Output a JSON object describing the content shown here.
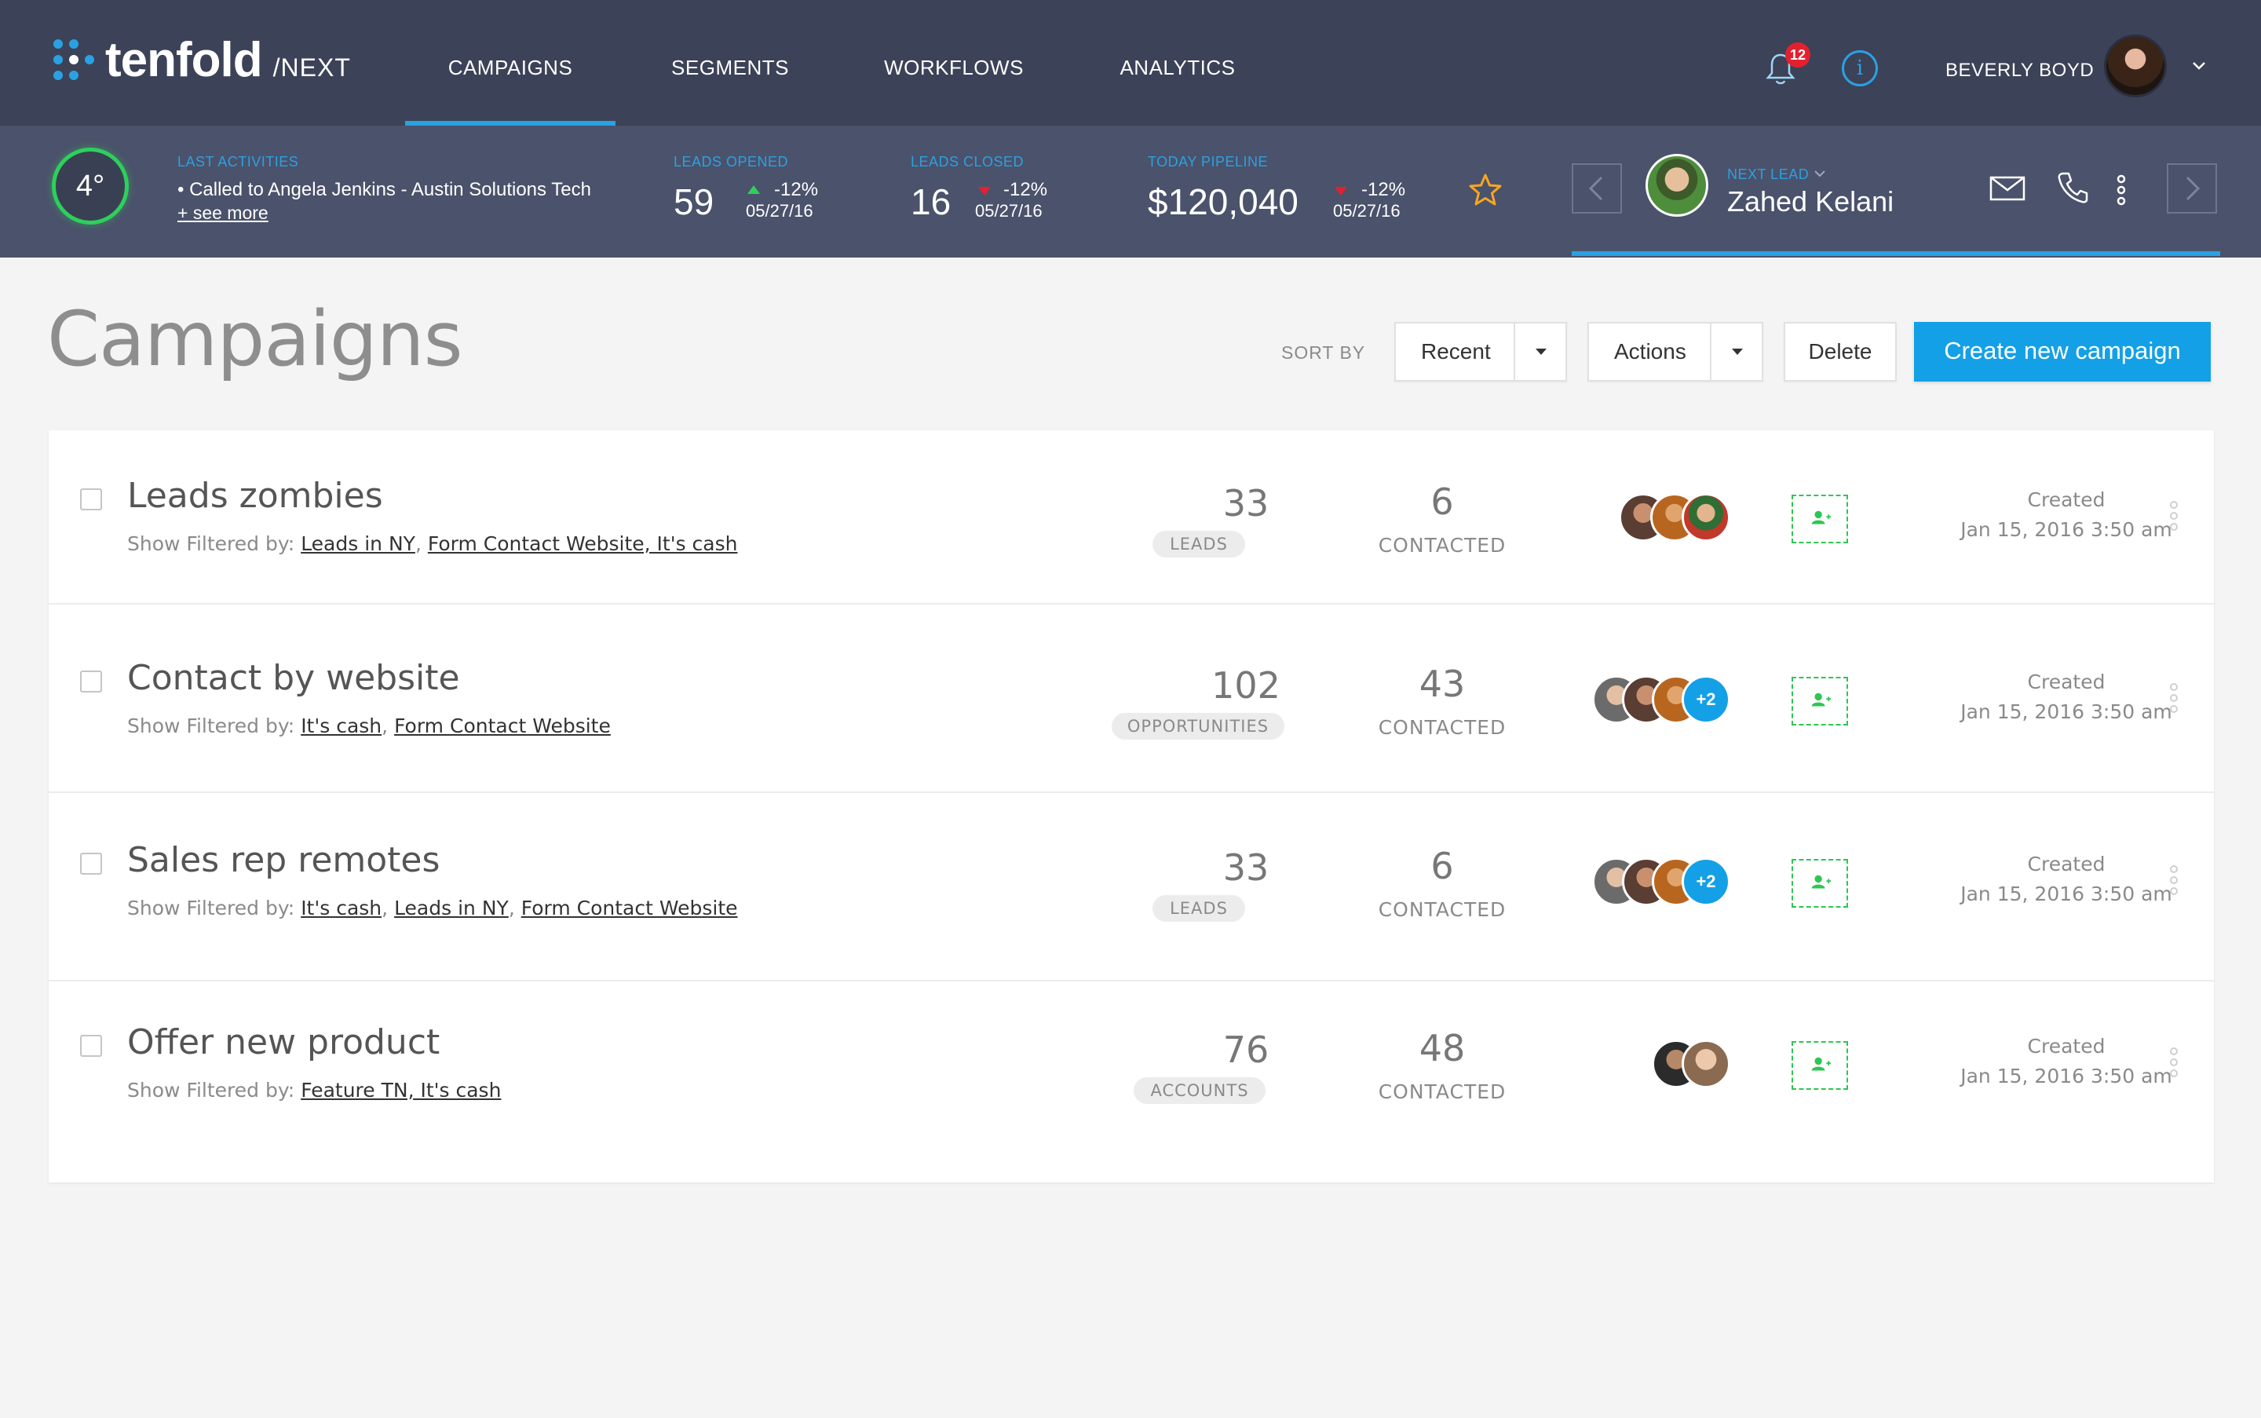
{
  "app": {
    "logo_word": "tenfold",
    "logo_suffix": "/NEXT"
  },
  "nav": {
    "tabs": [
      {
        "label": "CAMPAIGNS",
        "active": true
      },
      {
        "label": "SEGMENTS",
        "active": false
      },
      {
        "label": "WORKFLOWS",
        "active": false
      },
      {
        "label": "ANALYTICS",
        "active": false
      }
    ],
    "notifications_count": "12",
    "info_glyph": "i",
    "user_name": "BEVERLY BOYD"
  },
  "stats": {
    "temperature": "4°",
    "last_activities_label": "LAST  ACTIVITIES",
    "last_activity": "• Called to Angela Jenkins - Austin Solutions Tech",
    "see_more": "+ see more",
    "leads_opened": {
      "label": "LEADS OPENED",
      "value": "59",
      "change": "-12%",
      "date": "05/27/16",
      "trend": "up"
    },
    "leads_closed": {
      "label": "LEADS CLOSED",
      "value": "16",
      "change": "-12%",
      "date": "05/27/16",
      "trend": "down"
    },
    "pipeline": {
      "label": "TODAY PIPELINE",
      "value": "$120,040",
      "change": "-12%",
      "date": "05/27/16",
      "trend": "down"
    },
    "next_lead_label": "NEXT LEAD",
    "next_lead_name": "Zahed Kelani"
  },
  "page": {
    "title": "Campaigns",
    "sort_by_label": "SORT BY",
    "sort_value": "Recent",
    "actions_label": "Actions",
    "delete_label": "Delete",
    "create_label": "Create new campaign"
  },
  "campaigns": [
    {
      "name": "Leads zombies",
      "filter_prefix": "Show Filtered  by:",
      "filters": [
        "Leads in NY",
        "Form Contact Website, It's cash"
      ],
      "count": "33",
      "count_label": "LEADS",
      "contacted": "6",
      "contacted_label": "CONTACTED",
      "avatars": 3,
      "more": "",
      "created_label": "Created",
      "created_date": "Jan 15, 2016 3:50 am"
    },
    {
      "name": "Contact by website",
      "filter_prefix": "Show Filtered  by:",
      "filters": [
        "It's cash",
        "Form Contact Website"
      ],
      "count": "102",
      "count_label": "OPPORTUNITIES",
      "contacted": "43",
      "contacted_label": "CONTACTED",
      "avatars": 3,
      "more": "+2",
      "created_label": "Created",
      "created_date": "Jan 15, 2016 3:50 am"
    },
    {
      "name": "Sales rep remotes",
      "filter_prefix": "Show Filtered  by:",
      "filters": [
        "It's cash",
        "Leads in NY",
        "Form Contact Website"
      ],
      "count": "33",
      "count_label": "LEADS",
      "contacted": "6",
      "contacted_label": "CONTACTED",
      "avatars": 3,
      "more": "+2",
      "created_label": "Created",
      "created_date": "Jan 15, 2016 3:50 am"
    },
    {
      "name": "Offer new product",
      "filter_prefix": "Show Filtered  by:",
      "filters": [
        "Feature TN, It's cash"
      ],
      "count": "76",
      "count_label": "ACCOUNTS",
      "contacted": "48",
      "contacted_label": "CONTACTED",
      "avatars": 2,
      "more": "",
      "created_label": "Created",
      "created_date": "Jan 15, 2016 3:50 am"
    }
  ],
  "icons": {
    "logo": "tenfold-logo-icon",
    "bell": "bell-icon",
    "info": "info-icon",
    "chevron": "chevron-down-icon",
    "star": "star-icon",
    "prev": "arrow-left-icon",
    "next": "arrow-right-icon",
    "mail": "mail-icon",
    "phone": "phone-icon",
    "more": "more-vertical-icon",
    "add_user": "add-user-icon"
  },
  "colors": {
    "nav_bg": "#3c4257",
    "stats_bg": "#4b526b",
    "accent": "#14a0e6",
    "positive": "#2dd05a",
    "negative": "#e5202e",
    "star": "#f5a623"
  }
}
